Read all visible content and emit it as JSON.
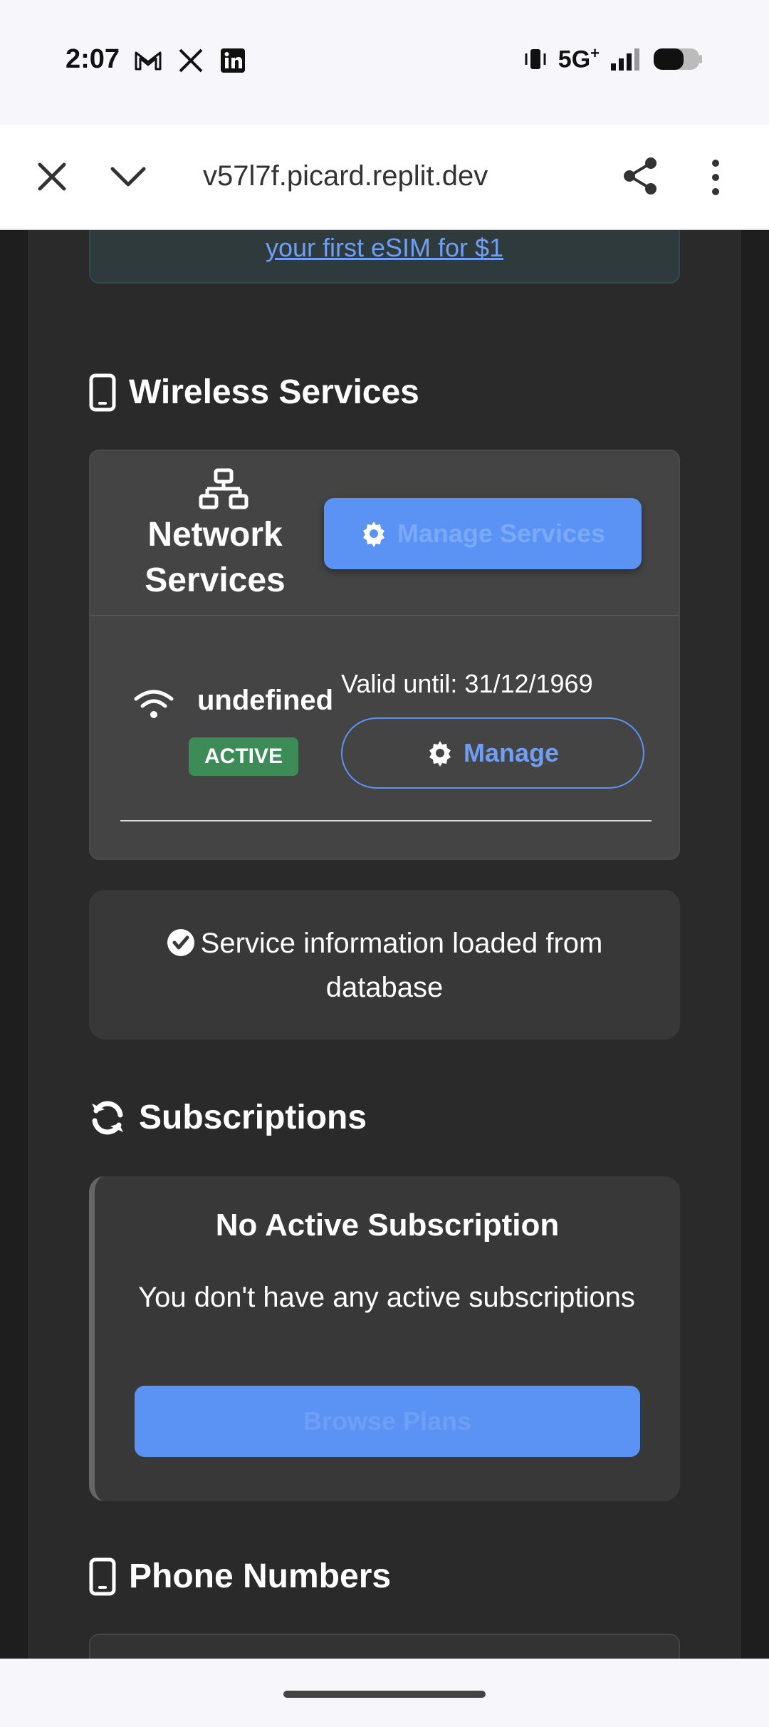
{
  "status_bar": {
    "time": "2:07",
    "network": "5G",
    "network_sup": "+",
    "app_icons": [
      "gmail-icon",
      "x-icon",
      "linkedin-icon"
    ]
  },
  "browser": {
    "url": "v57l7f.picard.replit.dev"
  },
  "promo": {
    "link_text": "your first eSIM for $1"
  },
  "wireless": {
    "section_title": "Wireless Services",
    "card_title": "Network Services",
    "manage_services_label": "Manage Services",
    "service": {
      "name": "undefined",
      "status": "ACTIVE",
      "valid_until": "Valid until: 31/12/1969",
      "manage_label": "Manage"
    }
  },
  "info": {
    "message": "Service information loaded from database"
  },
  "subscriptions": {
    "section_title": "Subscriptions",
    "empty_title": "No Active Subscription",
    "empty_desc": "You don't have any active subscriptions",
    "browse_label": "Browse Plans"
  },
  "phone_numbers": {
    "section_title": "Phone Numbers"
  },
  "colors": {
    "accent": "#5b93f5",
    "badge_active": "#3d8b57",
    "page_bg": "#2a2a2a"
  }
}
